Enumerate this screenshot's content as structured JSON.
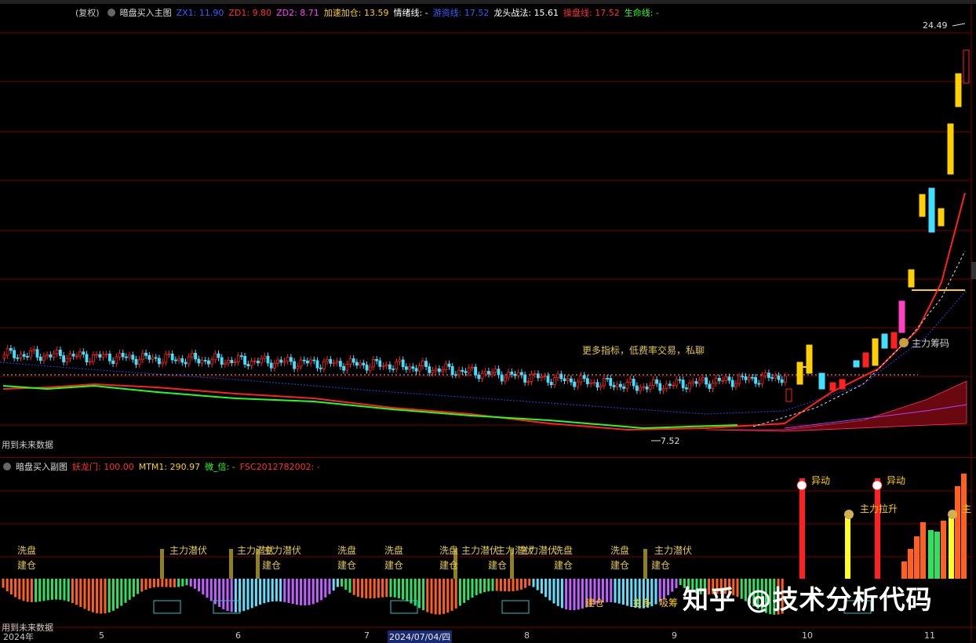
{
  "main_panel": {
    "title_prefix": "(复权)",
    "title": "暗盘买入主图",
    "indicators": [
      {
        "label": "ZX1:",
        "value": "11.90",
        "color": "#3060ff"
      },
      {
        "label": "ZD1:",
        "value": "9.80",
        "color": "#ff3030"
      },
      {
        "label": "ZD2:",
        "value": "8.71",
        "color": "#ff40ff"
      },
      {
        "label": "加速加仓:",
        "value": "13.59",
        "color": "#ffd000"
      },
      {
        "label": "情绪线:",
        "value": "-",
        "color": "#ffffff"
      },
      {
        "label": "游资线:",
        "value": "17.52",
        "color": "#3060ff"
      },
      {
        "label": "龙头战法:",
        "value": "15.61",
        "color": "#ffffff"
      },
      {
        "label": "操盘线:",
        "value": "17.52",
        "color": "#ff3030"
      },
      {
        "label": "生命线:",
        "value": "-",
        "color": "#30ff30"
      }
    ],
    "price_high_label": "24.49",
    "price_low_label": "7.52",
    "note": "更多指标，低费率交易，私聊",
    "left_caption": "用到未来数据",
    "chip_label": "主力筹码"
  },
  "sub_panel": {
    "title": "暗盘买入副图",
    "indicators": [
      {
        "label": "妖龙门:",
        "value": "100.00",
        "color": "#ff3030"
      },
      {
        "label": "MTM1:",
        "value": "290.97",
        "color": "#ffd000"
      },
      {
        "label": "微_信:",
        "value": "-",
        "color": "#30ff30"
      },
      {
        "label": "FSC2012782002:",
        "value": "-",
        "color": "#ff3030"
      }
    ],
    "signal_labels": {
      "wash": "洗盘",
      "build": "建仓",
      "latent": "主力潜伏",
      "anomaly": "异动",
      "pull": "主力拉升",
      "main_short": "主"
    },
    "bottom_caption": "用到未来数据",
    "fragment_labels": [
      "建仓",
      "主多",
      "吸筹"
    ]
  },
  "x_axis": {
    "labels": [
      "2024年",
      "5",
      "6",
      "7",
      "2024/07/04/四",
      "8",
      "9",
      "10",
      "11"
    ]
  },
  "watermark": "知乎 @技术分析代码",
  "colors": {
    "background": "#000000",
    "grid": "#7a0000",
    "up": "#ff2020",
    "down": "#40e0ff",
    "yellow_candle": "#ffd000",
    "ma_green": "#20ff20",
    "ma_red": "#ff2020",
    "ma_blue": "#2040ff"
  }
}
